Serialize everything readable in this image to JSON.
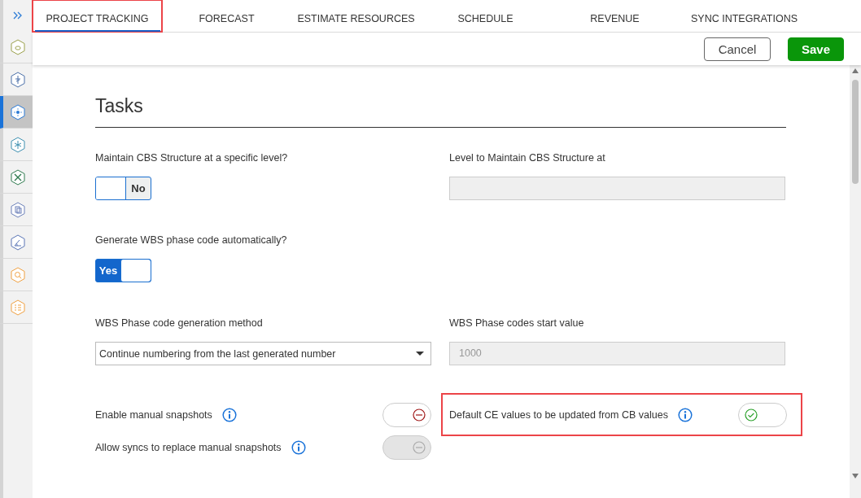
{
  "sidebar": {
    "items": [
      {
        "selected": false
      },
      {
        "selected": false
      },
      {
        "selected": true
      },
      {
        "selected": false
      },
      {
        "selected": false
      },
      {
        "selected": false
      },
      {
        "selected": false
      },
      {
        "selected": false
      },
      {
        "selected": false
      }
    ]
  },
  "tabs": [
    {
      "label": "PROJECT TRACKING",
      "selected": true,
      "highlighted": true
    },
    {
      "label": "FORECAST",
      "selected": false,
      "highlighted": false
    },
    {
      "label": "ESTIMATE RESOURCES",
      "selected": false,
      "highlighted": false
    },
    {
      "label": "SCHEDULE",
      "selected": false,
      "highlighted": false
    },
    {
      "label": "REVENUE",
      "selected": false,
      "highlighted": false
    },
    {
      "label": "SYNC INTEGRATIONS",
      "selected": false,
      "highlighted": false
    }
  ],
  "toolbar": {
    "buttons": [
      {
        "label": "Cancel",
        "kind": "secondary"
      },
      {
        "label": "Save",
        "kind": "primary"
      }
    ]
  },
  "section": {
    "title": "Tasks"
  },
  "form_rows": [
    {
      "left": {
        "kind": "switch",
        "label": "Maintain CBS Structure at a specific level?",
        "on": false,
        "state_label": "No"
      },
      "right": {
        "kind": "text",
        "label": "Level to Maintain CBS Structure at",
        "disabled": true
      }
    },
    {
      "left": {
        "kind": "switch",
        "label": "Generate WBS phase code automatically?",
        "on": true,
        "state_label": "Yes"
      }
    },
    {
      "left": {
        "kind": "select",
        "label": "WBS Phase code generation method",
        "value": "Continue numbering from the last generated number"
      },
      "right": {
        "kind": "text",
        "label": "WBS Phase codes start value",
        "value": "1000",
        "disabled": true
      }
    },
    {
      "left": {
        "kind": "options",
        "items": [
          {
            "label": "Enable manual snapshots",
            "on": false,
            "disabled": false
          },
          {
            "label": "Allow syncs to replace manual snapshots",
            "on": false,
            "disabled": true
          }
        ]
      },
      "right": {
        "kind": "options",
        "highlighted": true,
        "items": [
          {
            "label": "Default CE values to be updated from CB values",
            "on": true,
            "disabled": false
          }
        ]
      }
    }
  ]
}
